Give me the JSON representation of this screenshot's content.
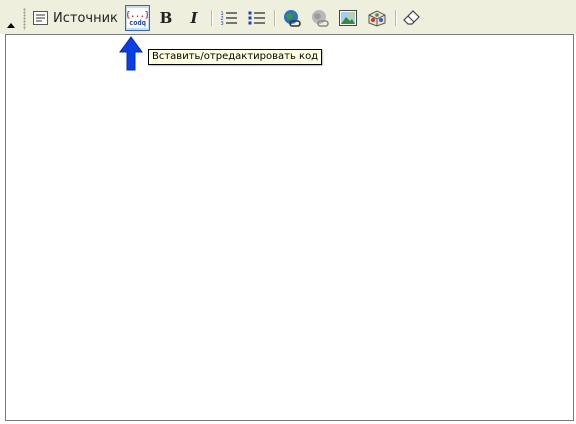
{
  "toolbar": {
    "source_label": "Источник",
    "codeq_icon_text_top": "{...}",
    "codeq_icon_text_bottom": "codq",
    "bold_glyph": "B",
    "italic_glyph": "I",
    "ordered_list_numbers": [
      "1",
      "2",
      "3"
    ],
    "icons": [
      "collapse-toolbar-icon",
      "source-icon",
      "codeq-icon",
      "bold-icon",
      "italic-icon",
      "ordered-list-icon",
      "bullet-list-icon",
      "link-icon",
      "unlink-icon",
      "image-icon",
      "table-box-icon",
      "eraser-icon"
    ]
  },
  "tooltip": {
    "text": "Вставить/отредактировать код"
  },
  "colors": {
    "toolbar_bg": "#efefde",
    "highlight_bg": "#c5dcf5",
    "highlight_border": "#316ac5",
    "arrow": "#0a3ee6",
    "tooltip_bg": "#ffffe1"
  }
}
